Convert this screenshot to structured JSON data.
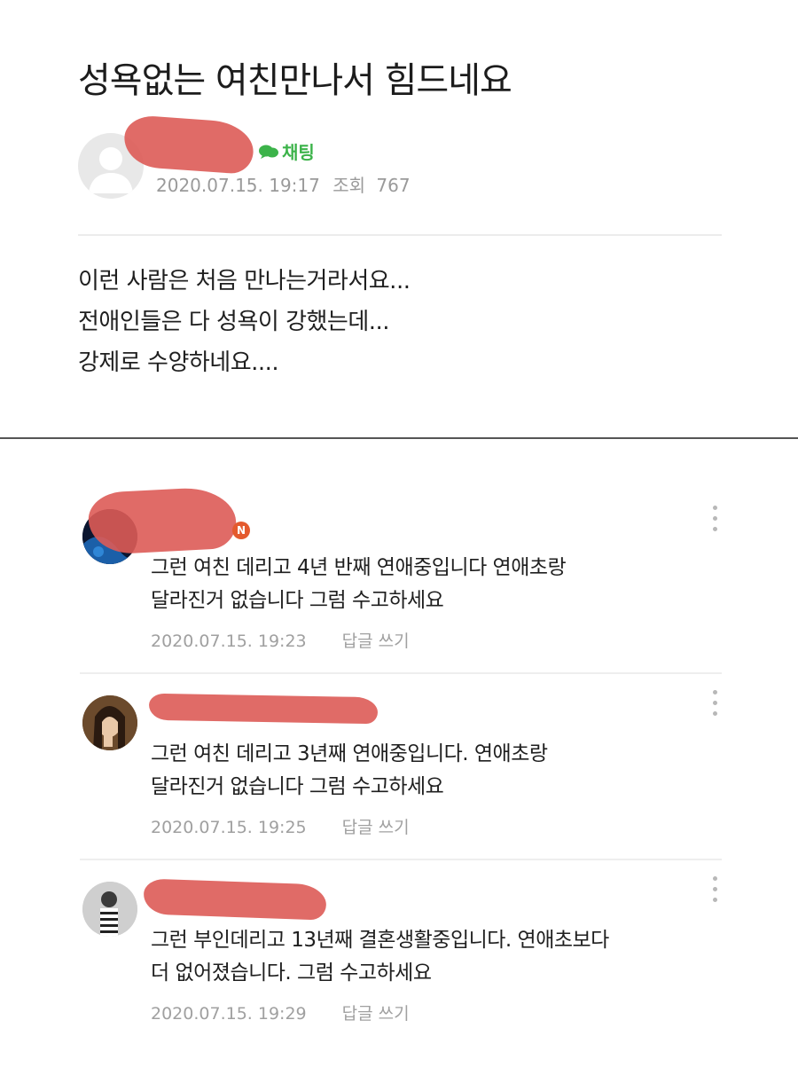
{
  "post": {
    "title": "성욕없는 여친만나서 힘드네요",
    "chat_label": "채팅",
    "date": "2020.07.15. 19:17",
    "views_label": "조회",
    "views": "767",
    "body_lines": [
      "이런 사람은 처음 만나는거라서요...",
      "전애인들은 다 성욕이 강했는데...",
      "강제로 수양하네요...."
    ]
  },
  "comments": [
    {
      "lines": [
        "그런 여친 데리고 4년 반째 연애중입니다 연애초랑",
        "달라진거 없습니다 그럼 수고하세요"
      ],
      "date": "2020.07.15. 19:23",
      "reply_label": "답글 쓰기",
      "badge": "N"
    },
    {
      "lines": [
        "그런 여친 데리고 3년째 연애중입니다. 연애초랑",
        "달라진거 없습니다 그럼 수고하세요"
      ],
      "date": "2020.07.15. 19:25",
      "reply_label": "답글 쓰기"
    },
    {
      "lines": [
        "그런 부인데리고 13년째 결혼생활중입니다. 연애초보다",
        "더 없어졌습니다. 그럼 수고하세요"
      ],
      "date": "2020.07.15. 19:29",
      "reply_label": "답글 쓰기"
    }
  ],
  "colors": {
    "redaction": "#dd5b57",
    "chat_green": "#3cb34a",
    "meta_gray": "#9a9a9a"
  }
}
